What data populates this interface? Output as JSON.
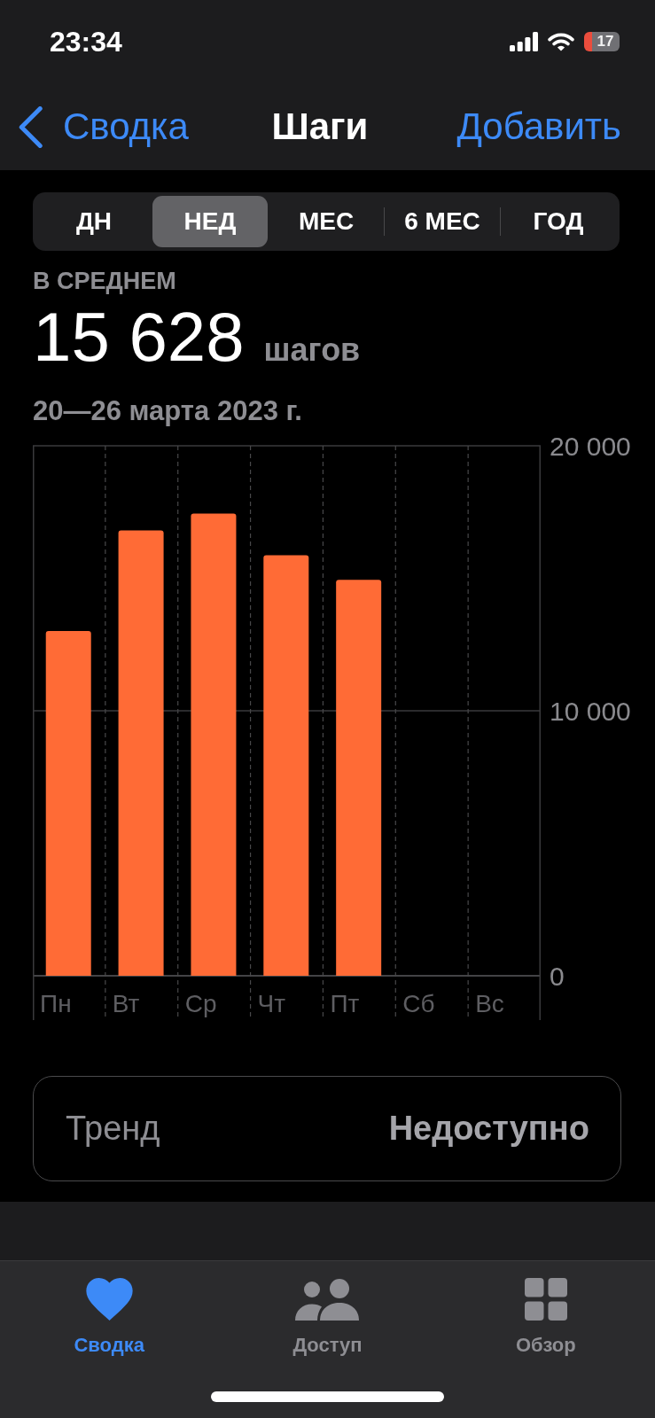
{
  "status_bar": {
    "time": "23:34",
    "battery": "17"
  },
  "nav_bar": {
    "back_label": "Сводка",
    "title": "Шаги",
    "action": "Добавить"
  },
  "period_tabs": [
    {
      "label": "ДН",
      "selected": false
    },
    {
      "label": "НЕД",
      "selected": true
    },
    {
      "label": "МЕС",
      "selected": false
    },
    {
      "label": "6 МЕС",
      "selected": false
    },
    {
      "label": "ГОД",
      "selected": false
    }
  ],
  "summary": {
    "label": "В СРЕДНЕМ",
    "value": "15 628",
    "unit": "шагов",
    "date_range": "20—26 марта 2023 г."
  },
  "chart": {
    "chart_data": {
      "type": "bar",
      "categories": [
        "Пн",
        "Вт",
        "Ср",
        "Чт",
        "Пт",
        "Сб",
        "Вс"
      ],
      "series": [
        {
          "color": "#ff6b36",
          "values": [
            13010,
            16810,
            17440,
            15870,
            14940,
            null,
            null
          ]
        }
      ],
      "ylim": [
        0,
        20000
      ],
      "yticks": [
        0,
        {
          "value": 10000,
          "label": "10 000"
        },
        {
          "value": 20000,
          "label": "20 000"
        }
      ]
    }
  },
  "trend": {
    "label": "Тренд",
    "value": "Недоступно"
  },
  "tab_bar": [
    {
      "kind": "summary",
      "label": "Сводка",
      "selected": true
    },
    {
      "kind": "sharing",
      "label": "Доступ",
      "selected": false
    },
    {
      "kind": "browse",
      "label": "Обзор",
      "selected": false
    }
  ]
}
